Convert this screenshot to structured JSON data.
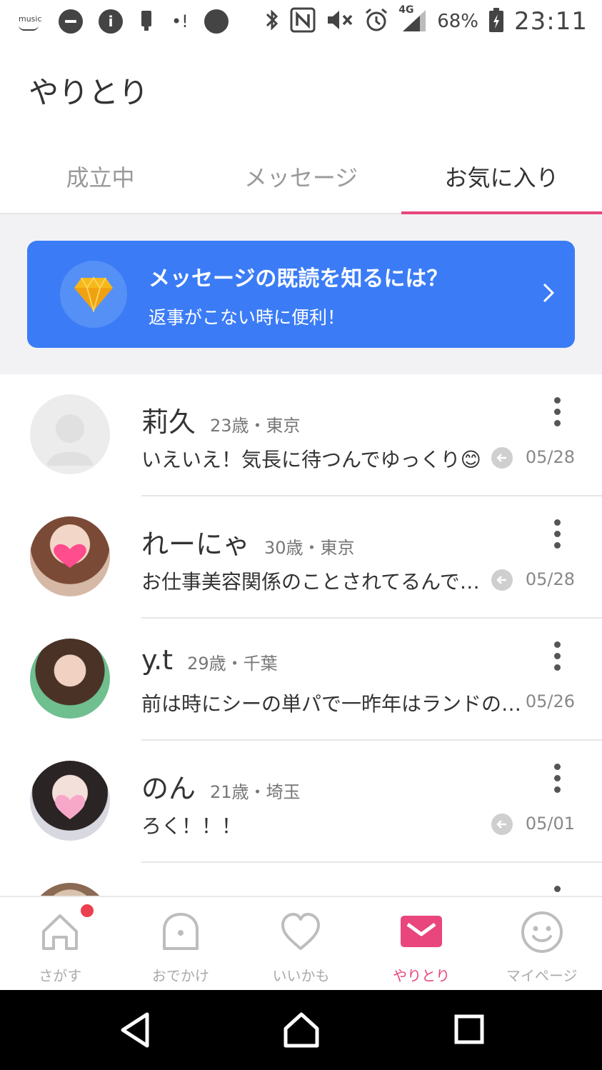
{
  "status_bar": {
    "music_label": "music",
    "notification_glyph": "•!",
    "battery_percent": "68%",
    "network_label": "4G",
    "time": "23:11"
  },
  "header": {
    "title": "やりとり"
  },
  "tabs": [
    {
      "label": "成立中",
      "active": false
    },
    {
      "label": "メッセージ",
      "active": false
    },
    {
      "label": "お気に入り",
      "active": true
    }
  ],
  "banner": {
    "title": "メッセージの既読を知るには？",
    "subtitle": "返事がこない時に便利！",
    "icon": "diamond-icon"
  },
  "conversations": [
    {
      "name": "莉久",
      "meta": "23歳・東京",
      "preview": "いえいえ！気長に待つんでゆっくり😊",
      "date": "05/28",
      "replied": true
    },
    {
      "name": "れーにゃ",
      "meta": "30歳・東京",
      "preview": "お仕事美容関係のことされてるんですね😊",
      "date": "05/28",
      "replied": true
    },
    {
      "name": "y.t",
      "meta": "29歳・千葉",
      "preview": "前は時にシーの単パで一昨年はランドの方に",
      "date": "05/26",
      "replied": false
    },
    {
      "name": "のん",
      "meta": "21歳・埼玉",
      "preview": "ろく！！！",
      "date": "05/01",
      "replied": true
    }
  ],
  "bottom_nav": [
    {
      "label": "さがす",
      "icon": "home-icon",
      "active": false,
      "badge": true
    },
    {
      "label": "おでかけ",
      "icon": "ghost-icon",
      "active": false,
      "badge": false
    },
    {
      "label": "いいかも",
      "icon": "heart-icon",
      "active": false,
      "badge": false
    },
    {
      "label": "やりとり",
      "icon": "envelope-icon",
      "active": true,
      "badge": false
    },
    {
      "label": "マイページ",
      "icon": "smiley-icon",
      "active": false,
      "badge": false
    }
  ],
  "colors": {
    "accent_pink": "#e8467c",
    "banner_blue": "#3b7cf6",
    "badge_red": "#ec3f4f",
    "gray_bg": "#f2f2f4"
  }
}
